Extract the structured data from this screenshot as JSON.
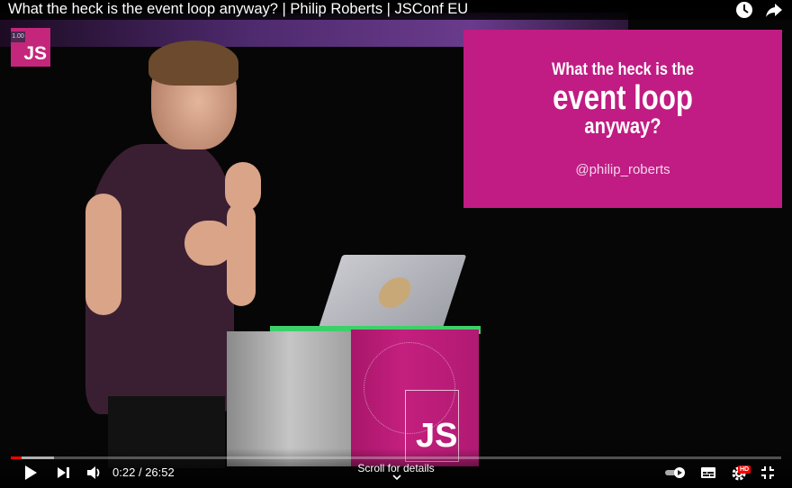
{
  "video": {
    "title": "What the heck is the event loop anyway? | Philip Roberts | JSConf EU",
    "speed_badge": "1.00",
    "logo_text": "JS",
    "progress": 0.014
  },
  "slide": {
    "line1": "What the heck is the",
    "line2": "event loop",
    "line3": "anyway?",
    "handle": "@philip_roberts"
  },
  "podium": {
    "text": "JS"
  },
  "controls": {
    "current_time": "0:22",
    "separator": "/",
    "duration": "26:52",
    "scroll_hint": "Scroll for details",
    "hd_badge": "HD"
  },
  "colors": {
    "accent": "#ff0000",
    "slide": "#c01c83"
  },
  "icons": [
    "clock-icon",
    "share-icon",
    "play-icon",
    "next-icon",
    "volume-icon",
    "autoplay-toggle-icon",
    "subtitles-icon",
    "settings-icon",
    "exit-fullscreen-icon",
    "chevron-down-icon"
  ]
}
